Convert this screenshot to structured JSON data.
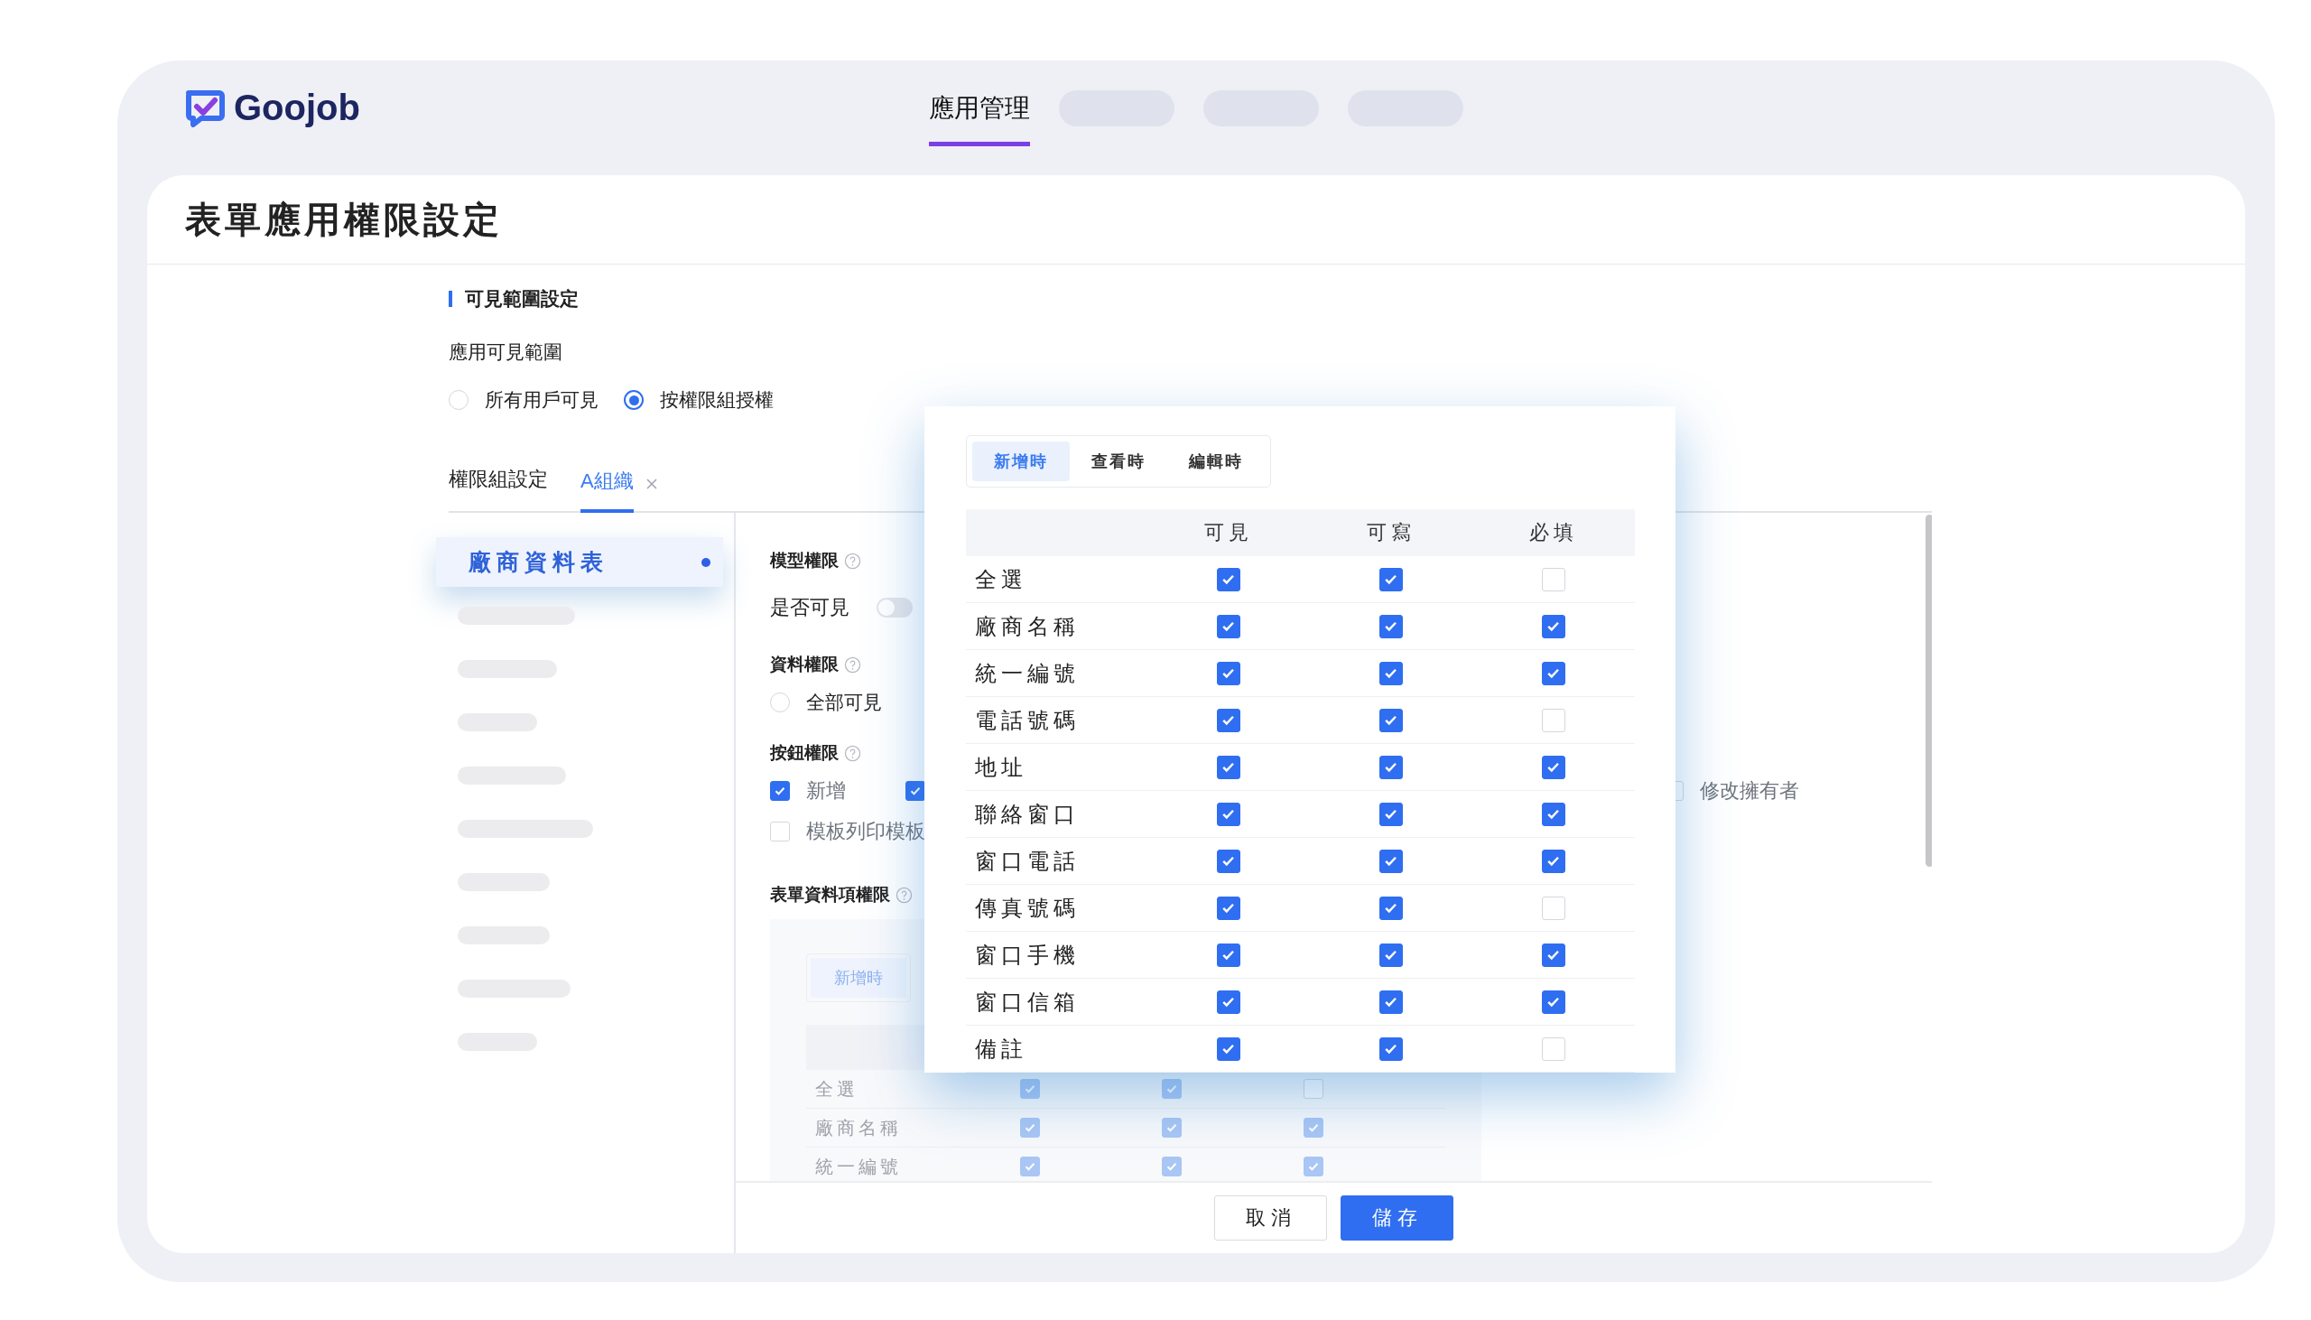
{
  "header": {
    "logo": "Goojob",
    "nav": [
      {
        "label": "應用管理",
        "selected": true
      }
    ]
  },
  "page_title": "表單應用權限設定",
  "visibility": {
    "heading": "可見範圍設定",
    "label": "應用可見範圍",
    "options": [
      {
        "label": "所有用戶可見",
        "selected": false
      },
      {
        "label": "按權限組授權",
        "selected": true
      }
    ]
  },
  "group_tabs": {
    "label": "權限組設定",
    "tabs": [
      {
        "label": "A組織",
        "selected": true,
        "closable": true
      }
    ]
  },
  "forms": [
    {
      "label": "廠商資料表",
      "selected": true
    }
  ],
  "model_permission": {
    "heading": "模型權限",
    "toggle_label": "是否可見",
    "on": false
  },
  "data_permission": {
    "heading": "資料權限",
    "options": [
      {
        "label": "全部可見",
        "selected": false
      }
    ]
  },
  "button_permission": {
    "heading": "按鈕權限",
    "rows": [
      [
        {
          "label": "新增",
          "checked": true
        },
        {
          "checked": true
        },
        {
          "label": "修改擁有者",
          "checked": false
        }
      ],
      [
        {
          "label": "模板列印模板",
          "checked": false
        }
      ]
    ]
  },
  "field_permission": {
    "heading": "表單資料項權限",
    "tabs": [
      {
        "label": "新增時",
        "selected": true
      }
    ],
    "rows": [
      {
        "label": "全選",
        "checks": [
          true,
          true,
          false
        ]
      },
      {
        "label": "廠商名稱",
        "checks": [
          true,
          true,
          true
        ]
      },
      {
        "label": "統一編號",
        "checks": [
          true,
          true,
          true
        ]
      }
    ]
  },
  "popup": {
    "tabs": [
      {
        "label": "新增時",
        "selected": true
      },
      {
        "label": "查看時",
        "selected": false
      },
      {
        "label": "編輯時",
        "selected": false
      }
    ],
    "columns": [
      "可見",
      "可寫",
      "必填"
    ],
    "rows": [
      {
        "label": "全選",
        "checks": [
          true,
          true,
          false
        ]
      },
      {
        "label": "廠商名稱",
        "checks": [
          true,
          true,
          true
        ]
      },
      {
        "label": "統一編號",
        "checks": [
          true,
          true,
          true
        ]
      },
      {
        "label": "電話號碼",
        "checks": [
          true,
          true,
          false
        ]
      },
      {
        "label": "地址",
        "checks": [
          true,
          true,
          true
        ]
      },
      {
        "label": "聯絡窗口",
        "checks": [
          true,
          true,
          true
        ]
      },
      {
        "label": "窗口電話",
        "checks": [
          true,
          true,
          true
        ]
      },
      {
        "label": "傳真號碼",
        "checks": [
          true,
          true,
          false
        ]
      },
      {
        "label": "窗口手機",
        "checks": [
          true,
          true,
          true
        ]
      },
      {
        "label": "窗口信箱",
        "checks": [
          true,
          true,
          true
        ]
      },
      {
        "label": "備註",
        "checks": [
          true,
          true,
          false
        ]
      }
    ]
  },
  "actions": [
    {
      "label": "取消",
      "kind": "secondary"
    },
    {
      "label": "儲存",
      "kind": "primary"
    }
  ]
}
